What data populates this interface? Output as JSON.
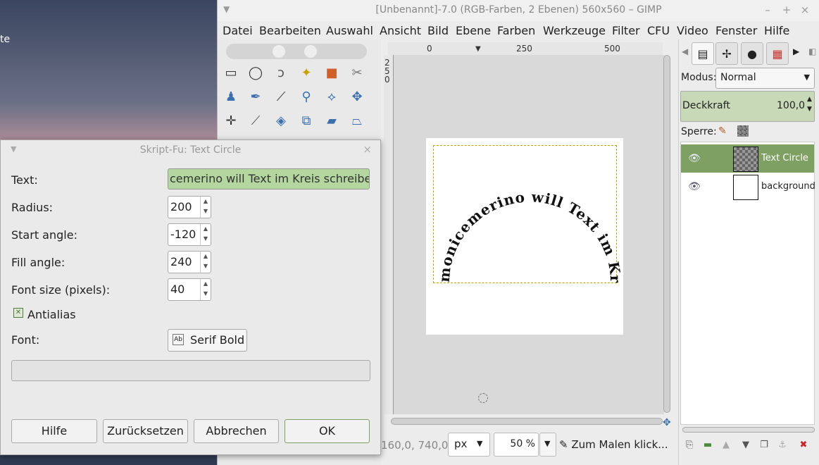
{
  "desktop": {
    "label": "te"
  },
  "window": {
    "title": "[Unbenannt]-7.0 (RGB-Farben, 2 Ebenen) 560x560 – GIMP",
    "controls": [
      "–",
      "+",
      "×"
    ]
  },
  "menu": [
    "Datei",
    "Bearbeiten",
    "Auswahl",
    "Ansicht",
    "Bild",
    "Ebene",
    "Farben",
    "Werkzeuge",
    "Filter",
    "CFU",
    "Video",
    "Fenster",
    "Hilfe"
  ],
  "rulers": {
    "top": [
      "0",
      "250",
      "500"
    ],
    "left": [
      "2",
      "5",
      "0"
    ]
  },
  "canvas": {
    "circle_text": "monicemerino will Text im Kreis schreiben"
  },
  "status": {
    "coords": "160,0, 740,0",
    "unit": "px",
    "zoom": "50 %",
    "message": "Zum Malen klick..."
  },
  "dock": {
    "mode_label": "Modus:",
    "mode_value": "Normal",
    "opacity_label": "Deckkraft",
    "opacity_value": "100,0",
    "lock_label": "Sperre:",
    "layers": [
      {
        "name": "Text Circle",
        "selected": true
      },
      {
        "name": "background",
        "selected": false
      }
    ]
  },
  "dialog": {
    "title": "Skript-Fu: Text Circle",
    "text_label": "Text:",
    "text_value": "cemerino will Text im Kreis schreiben",
    "radius_label": "Radius:",
    "radius_value": "200",
    "start_angle_label": "Start angle:",
    "start_angle_value": "-120",
    "fill_angle_label": "Fill angle:",
    "fill_angle_value": "240",
    "font_size_label": "Font size (pixels):",
    "font_size_value": "40",
    "antialias_label": "Antialias",
    "antialias_checked": true,
    "font_label": "Font:",
    "font_value": "Serif Bold",
    "buttons": {
      "help": "Hilfe",
      "reset": "Zurücksetzen",
      "cancel": "Abbrechen",
      "ok": "OK"
    }
  }
}
